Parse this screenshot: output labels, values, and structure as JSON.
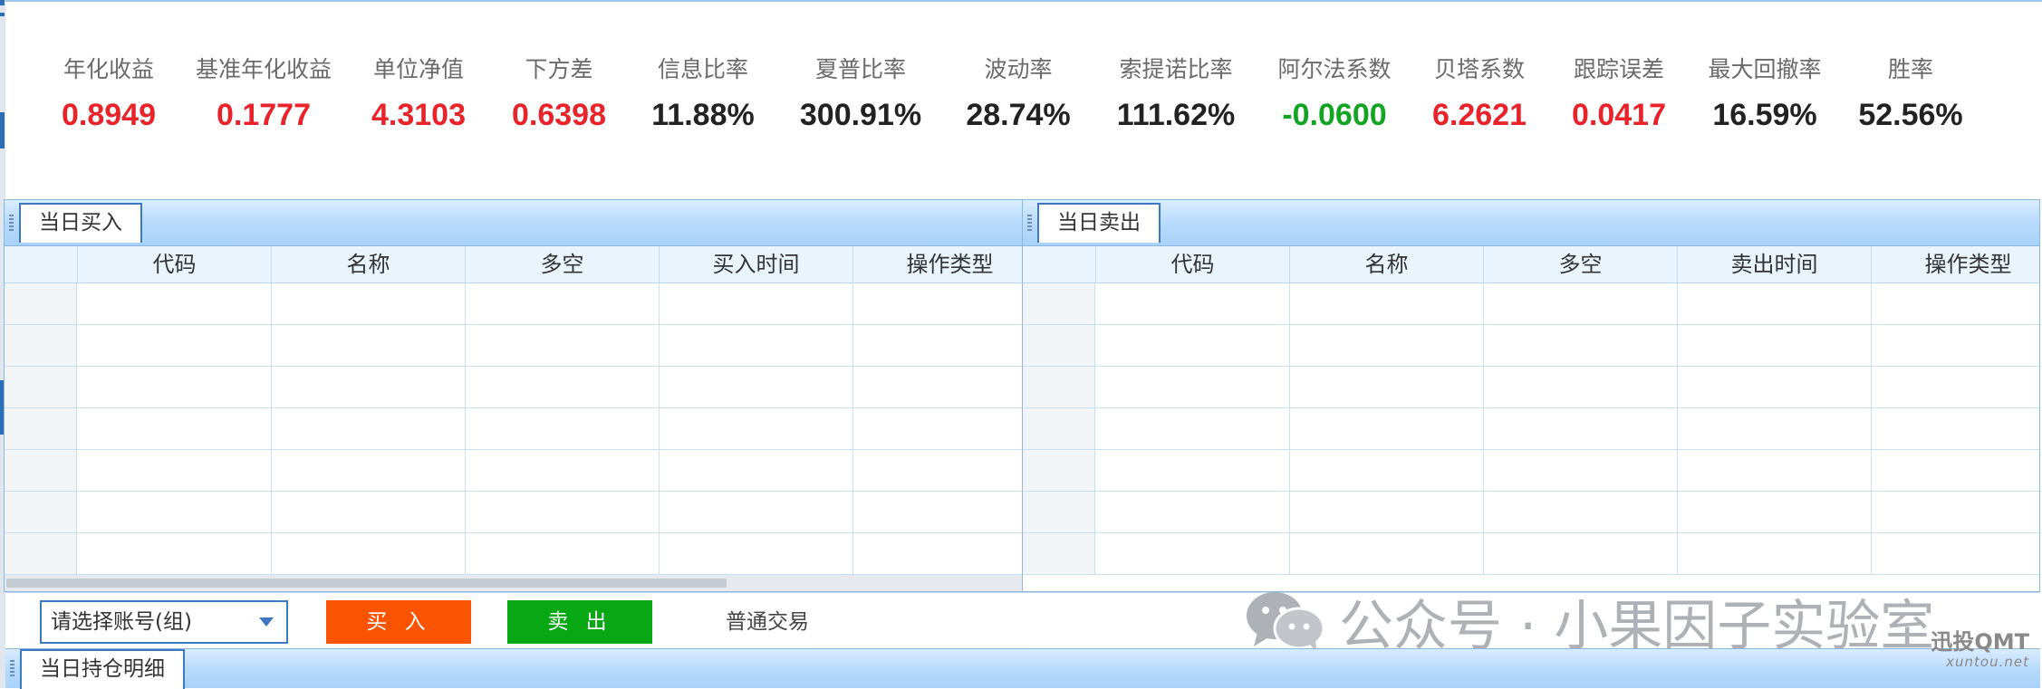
{
  "metrics": [
    {
      "label": "年化收益",
      "value": "0.8949",
      "color": "#e8232a"
    },
    {
      "label": "基准年化收益",
      "value": "0.1777",
      "color": "#e8232a"
    },
    {
      "label": "单位净值",
      "value": "4.3103",
      "color": "#e8232a"
    },
    {
      "label": "下方差",
      "value": "0.6398",
      "color": "#e8232a"
    },
    {
      "label": "信息比率",
      "value": "11.88%",
      "color": "#222222"
    },
    {
      "label": "夏普比率",
      "value": "300.91%",
      "color": "#222222"
    },
    {
      "label": "波动率",
      "value": "28.74%",
      "color": "#222222"
    },
    {
      "label": "索提诺比率",
      "value": "111.62%",
      "color": "#222222"
    },
    {
      "label": "阿尔法系数",
      "value": "-0.0600",
      "color": "#12a422"
    },
    {
      "label": "贝塔系数",
      "value": "6.2621",
      "color": "#e8232a"
    },
    {
      "label": "跟踪误差",
      "value": "0.0417",
      "color": "#e8232a"
    },
    {
      "label": "最大回撤率",
      "value": "16.59%",
      "color": "#222222"
    },
    {
      "label": "胜率",
      "value": "52.56%",
      "color": "#222222"
    }
  ],
  "buy_panel": {
    "tab": "当日买入",
    "columns": [
      "代码",
      "名称",
      "多空",
      "买入时间",
      "操作类型"
    ]
  },
  "sell_panel": {
    "tab": "当日卖出",
    "columns": [
      "代码",
      "名称",
      "多空",
      "卖出时间",
      "操作类型"
    ]
  },
  "actions": {
    "account_placeholder": "请选择账号(组)",
    "buy_label": "买 入",
    "sell_label": "卖 出",
    "mode_label": "普通交易"
  },
  "watermark": "公众号 · 小果因子实验室",
  "holdings_tab": "当日持仓明细",
  "brand": {
    "name": "迅投QMT",
    "url": "xuntou.net"
  },
  "colors": {
    "up": "#e8232a",
    "down": "#12a422",
    "buy_button": "#fb5400",
    "sell_button": "#08a814",
    "accent": "#3d79c2"
  }
}
